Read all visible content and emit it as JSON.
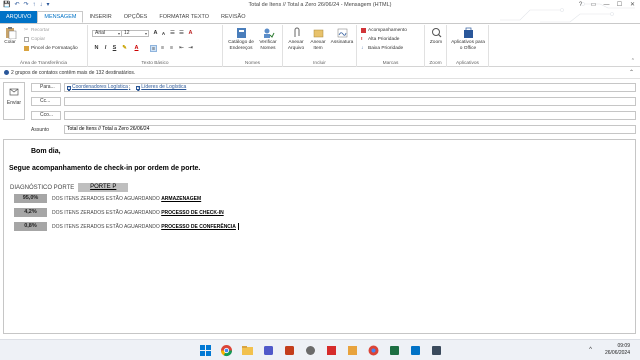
{
  "window": {
    "title": "Total de Itens // Total a Zero 26/06/24 - Mensagem (HTML)",
    "controls": [
      "?",
      "▭",
      "—",
      "☐",
      "✕"
    ],
    "qat_icons": [
      "save-icon",
      "undo-icon",
      "redo-icon",
      "up-arrow-icon",
      "down-arrow-icon",
      "customize-icon"
    ]
  },
  "tabs": {
    "file": "ARQUIVO",
    "items": [
      "MENSAGEM",
      "INSERIR",
      "OPÇÕES",
      "FORMATAR TEXTO",
      "REVISÃO"
    ]
  },
  "ribbon": {
    "clipboard": {
      "paste": "Colar",
      "cut": "Recortar",
      "copy": "Copiar",
      "format_painter": "Pincel de Formatação",
      "label": "Área de Transferência"
    },
    "text": {
      "font": "Arial",
      "size": "12",
      "bold": "N",
      "italic": "I",
      "underline": "S",
      "label": "Texto Básico"
    },
    "names": {
      "address_book": "Catálogo de Endereços",
      "check_names": "Verificar Nomes",
      "label": "Nomes"
    },
    "include": {
      "attach_file": "Anexar Arquivo",
      "attach_item": "Anexar Item",
      "signature": "Assinatura",
      "label": "Incluir"
    },
    "tags": {
      "follow_up": "Acompanhamento",
      "high": "Alta Prioridade",
      "low": "Baixa Prioridade",
      "label": "Marcas"
    },
    "zoom": {
      "zoom": "Zoom",
      "label": "Zoom"
    },
    "apps": {
      "apps": "Aplicativos para o Office",
      "label": "Aplicativos"
    }
  },
  "infobar": {
    "text": "2 grupos de contatos contêm mais de 132 destinatários."
  },
  "header": {
    "send": "Enviar",
    "to_label": "Para...",
    "cc_label": "Cc...",
    "bcc_label": "Cco...",
    "subject_label": "Assunto",
    "to_recipients": [
      "Coordenadores Logística",
      "Líderes de Logística"
    ],
    "subject": "Total de Itens // Total a Zero 26/06/24"
  },
  "body": {
    "greeting": "Bom dia,",
    "intro": "Segue acompanhamento de check-in por ordem de porte.",
    "diag_label": "DIAGNÓSTICO PORTE",
    "porte": "PORTE P",
    "rows": [
      {
        "pct": "95,0%",
        "text": "DOS ITENS ZERADOS ESTÃO AGUARDANDO",
        "bold": "ARMAZENAGEM"
      },
      {
        "pct": "4,2%",
        "text": "DOS ITENS ZERADOS ESTÃO AGUARDANDO",
        "bold": "PROCESSO DE CHECK-IN"
      },
      {
        "pct": "0,8%",
        "text": "DOS ITENS ZERADOS ESTÃO AGUARDANDO",
        "bold": "PROCESSO DE CONFERÊNCIA"
      }
    ]
  },
  "taskbar": {
    "time": "09:09",
    "date": "26/06/2024",
    "tray": "^"
  },
  "colors": {
    "accent": "#0072c6",
    "pct_bg": "#a6a6a6",
    "porte_bg": "#bfbfbf",
    "link": "#2b5797"
  }
}
